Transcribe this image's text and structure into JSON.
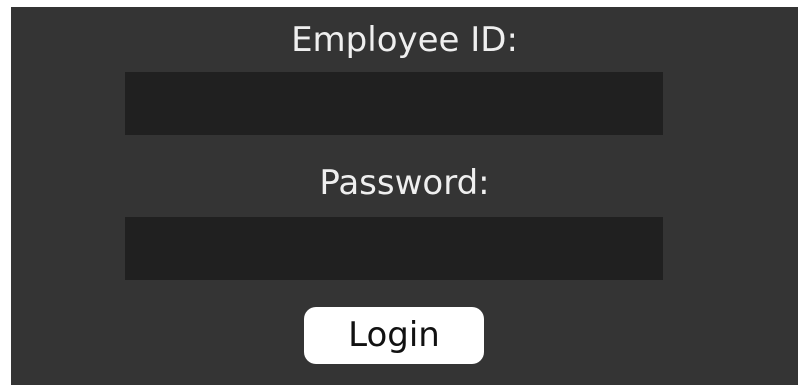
{
  "form": {
    "employee_id_label": "Employee ID:",
    "employee_id_value": "",
    "password_label": "Password:",
    "password_value": "",
    "login_label": "Login"
  },
  "colors": {
    "panel_background": "#343434",
    "field_background": "#202020",
    "label_text": "#efefef",
    "button_background": "#ffffff",
    "button_text": "#111111"
  }
}
